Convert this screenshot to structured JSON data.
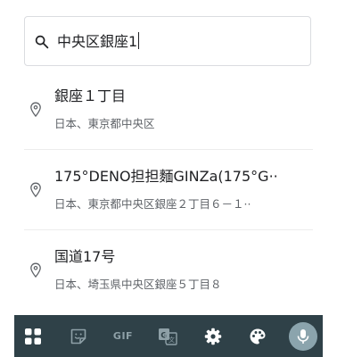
{
  "search": {
    "query": "中央区銀座1",
    "icon": "search-icon"
  },
  "suggestions": [
    {
      "title": "銀座１丁目",
      "subtitle": "日本、東京都中央区",
      "icon": "place-pin-icon"
    },
    {
      "title": "175°DENO担担麵GINZa(175°G··",
      "subtitle": "日本、東京都中央区銀座２丁目６－１··",
      "icon": "place-pin-icon"
    },
    {
      "title": "国道17号",
      "subtitle": "日本、埼玉県中央区銀座５丁目８",
      "icon": "place-pin-icon"
    }
  ],
  "keyboard_toolbar": {
    "items": [
      "apps-grid-icon",
      "sticker-icon",
      "gif-button",
      "translate-icon",
      "settings-gear-icon",
      "theme-palette-icon",
      "microphone-icon"
    ],
    "gif_label": "GIF",
    "background": "#2f4148",
    "icon_color": "#8ea0a7"
  }
}
